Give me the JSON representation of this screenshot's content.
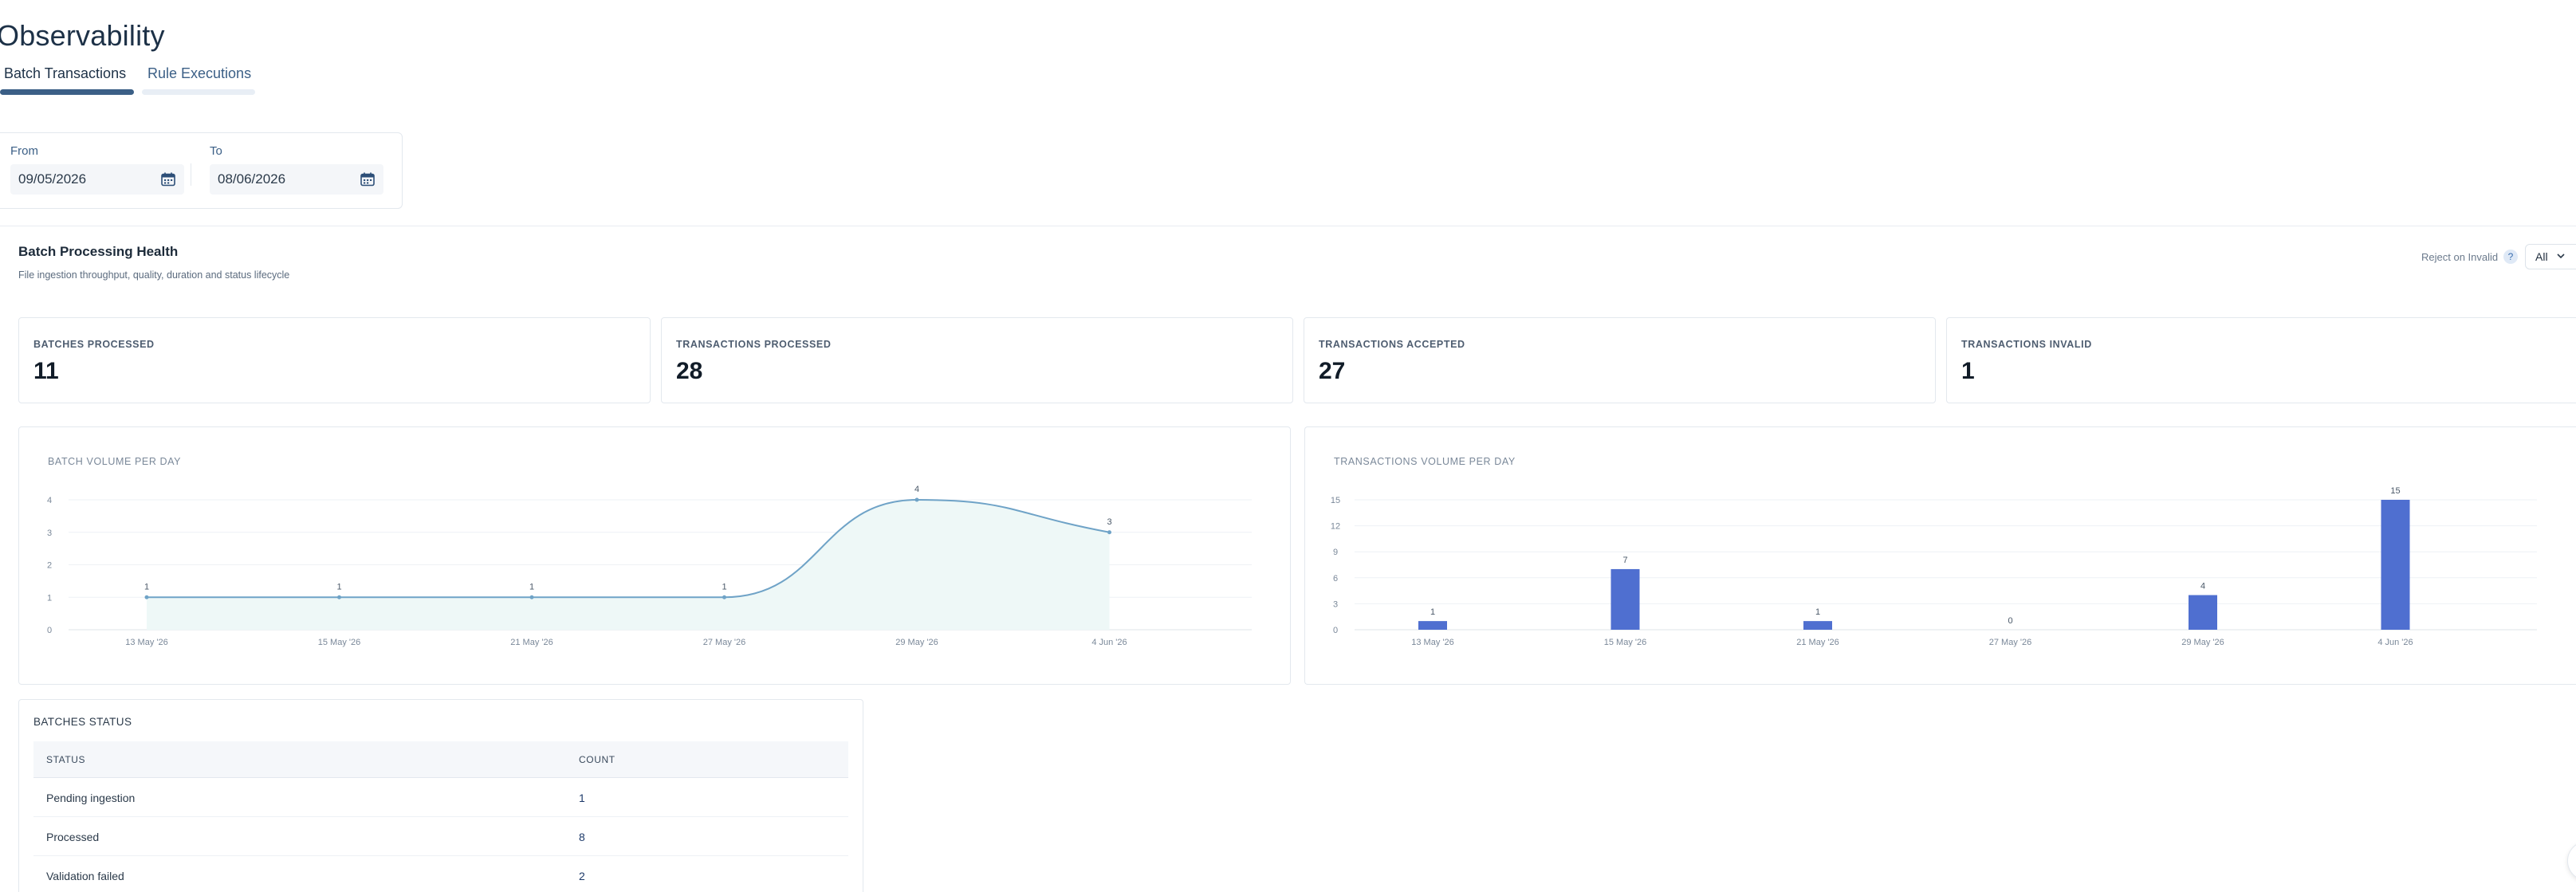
{
  "page": {
    "title": "Observability"
  },
  "tabs": [
    {
      "label": "Batch Transactions",
      "active": true
    },
    {
      "label": "Rule Executions",
      "active": false
    }
  ],
  "date_filter": {
    "from_label": "From",
    "from_value": "09/05/2026",
    "to_label": "To",
    "to_value": "08/06/2026",
    "icon": "calendar-icon"
  },
  "section": {
    "title": "Batch Processing Health",
    "subtitle": "File ingestion throughput, quality, duration and status lifecycle",
    "filter_label": "Reject on Invalid",
    "filter_help": "?",
    "filter_value": "All"
  },
  "stats": [
    {
      "label": "BATCHES PROCESSED",
      "value": "11"
    },
    {
      "label": "TRANSACTIONS PROCESSED",
      "value": "28"
    },
    {
      "label": "TRANSACTIONS ACCEPTED",
      "value": "27"
    },
    {
      "label": "TRANSACTIONS INVALID",
      "value": "1"
    }
  ],
  "chart_data": [
    {
      "type": "area",
      "title": "BATCH VOLUME PER DAY",
      "categories": [
        "13 May '26",
        "15 May '26",
        "21 May '26",
        "27 May '26",
        "29 May '26",
        "4 Jun '26"
      ],
      "values": [
        1,
        1,
        1,
        1,
        4,
        3
      ],
      "data_labels": [
        "1",
        "1",
        "1",
        "1",
        "4",
        "3"
      ],
      "ylim": [
        0,
        4
      ],
      "yticks": [
        "0",
        "1",
        "2",
        "3",
        "4"
      ],
      "grid": true,
      "color": "#6fa3c7",
      "fill": "#eef8f7"
    },
    {
      "type": "bar",
      "title": "TRANSACTIONS VOLUME PER DAY",
      "categories": [
        "13 May '26",
        "15 May '26",
        "21 May '26",
        "27 May '26",
        "29 May '26",
        "4 Jun '26"
      ],
      "values": [
        1,
        7,
        1,
        0,
        4,
        15
      ],
      "data_labels": [
        "1",
        "7",
        "1",
        "0",
        "4",
        "15"
      ],
      "ylim": [
        0,
        15
      ],
      "yticks": [
        "0",
        "3",
        "6",
        "9",
        "12",
        "15"
      ],
      "grid": true,
      "color": "#4f6fd0"
    }
  ],
  "batches_status": {
    "title": "BATCHES STATUS",
    "columns": [
      "STATUS",
      "COUNT"
    ],
    "rows": [
      {
        "status": "Pending ingestion",
        "count": "1"
      },
      {
        "status": "Processed",
        "count": "8"
      },
      {
        "status": "Validation failed",
        "count": "2"
      }
    ]
  }
}
